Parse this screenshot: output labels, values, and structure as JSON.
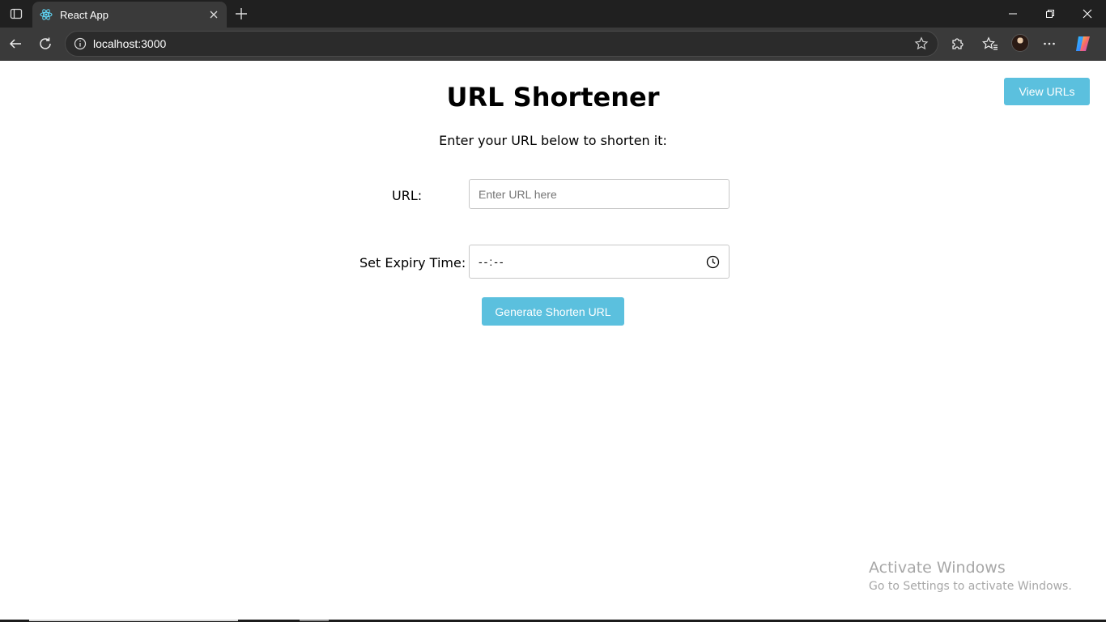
{
  "browser": {
    "tab_title": "React App",
    "address": "localhost:3000",
    "icons": {
      "tab_strip": "tab-strip-icon",
      "favicon": "react-icon",
      "close": "close-icon",
      "new_tab": "plus-icon",
      "back": "back-arrow-icon",
      "refresh": "refresh-icon",
      "info": "info-icon",
      "favorite": "star-icon",
      "extensions": "puzzle-icon",
      "favorites": "favorites-icon",
      "more": "more-icon",
      "copilot": "copilot-icon"
    }
  },
  "page": {
    "view_urls_label": "View URLs",
    "title": "URL Shortener",
    "subtitle": "Enter your URL below to shorten it:",
    "url_label": "URL:",
    "url_placeholder": "Enter URL here",
    "expiry_label": "Set Expiry Time:",
    "expiry_value": "--:--",
    "generate_label": "Generate Shorten URL"
  },
  "watermark": {
    "title": "Activate Windows",
    "subtitle": "Go to Settings to activate Windows."
  },
  "colors": {
    "accent": "#5bc0de",
    "chrome_dark": "#202020",
    "chrome_toolbar": "#3a3a3a"
  }
}
